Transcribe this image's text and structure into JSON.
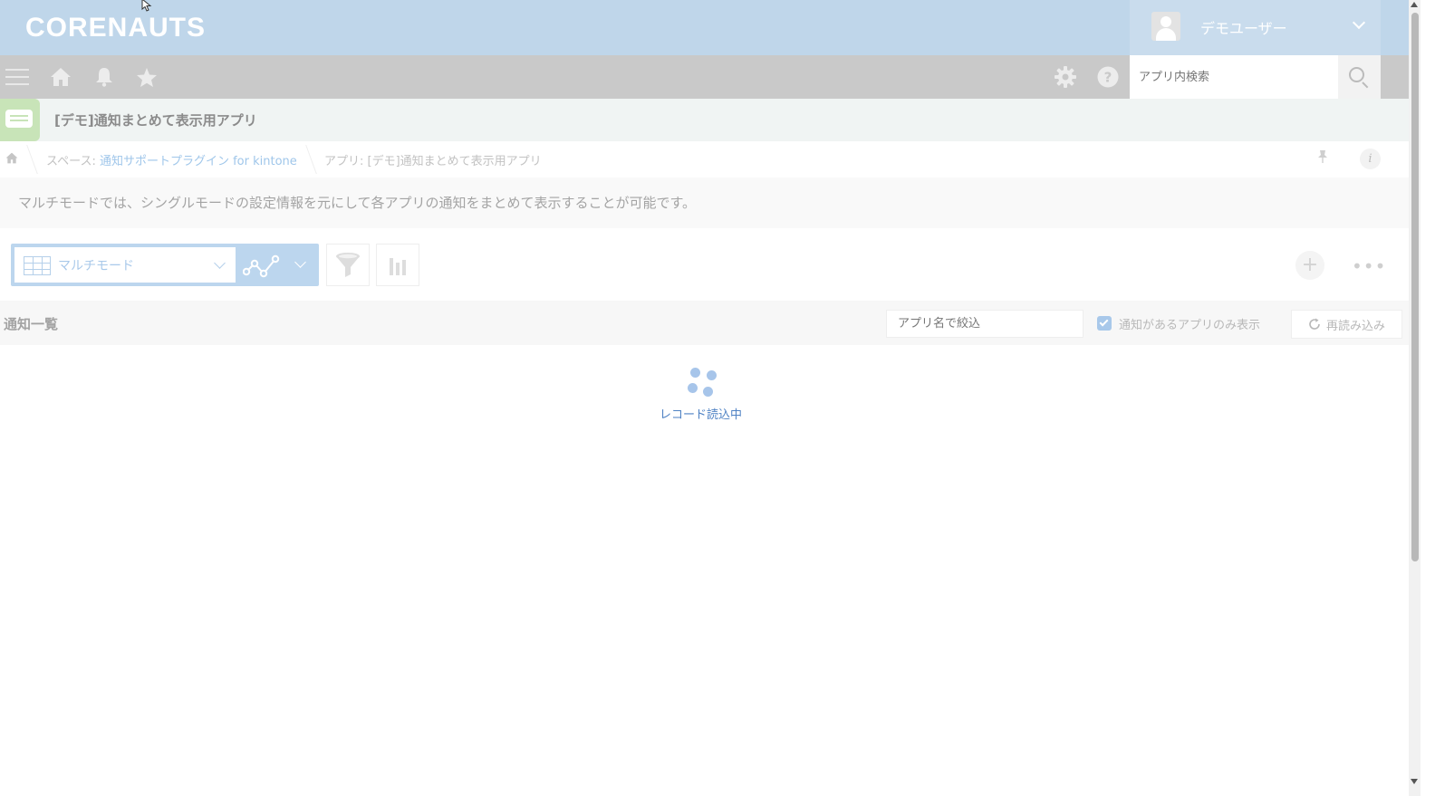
{
  "header": {
    "logo": "CORENAUTS",
    "user_name": "デモユーザー"
  },
  "navbar": {
    "search_placeholder": "アプリ内検索"
  },
  "app": {
    "title": "[デモ]通知まとめて表示用アプリ"
  },
  "breadcrumb": {
    "space_prefix": "スペース: ",
    "space_link": "通知サポートプラグイン for kintone",
    "app_label": "アプリ: [デモ]通知まとめて表示用アプリ"
  },
  "description": "マルチモードでは、シングルモードの設定情報を元にして各アプリの通知をまとめて表示することが可能です。",
  "toolbar": {
    "view_label": "マルチモード",
    "more_label": "•••"
  },
  "list": {
    "title": "通知一覧",
    "filter_placeholder": "アプリ名で絞込",
    "only_with_notifications_label": "通知があるアプリのみ表示",
    "only_with_notifications_checked": true,
    "reload_label": "再読み込み"
  },
  "loading": {
    "label": "レコード読込中"
  },
  "colors": {
    "header_bg": "#bfd6ea",
    "navbar_bg": "#c9c9c9",
    "accent": "#bcd6ee",
    "loading_text": "#4f82c4"
  }
}
